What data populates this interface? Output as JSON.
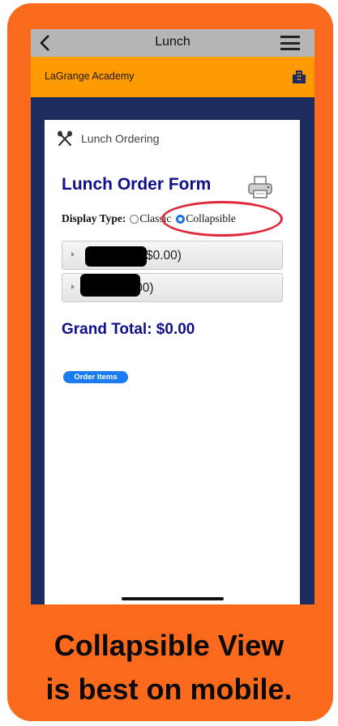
{
  "topbar": {
    "title": "Lunch",
    "back_icon": "chevron-left-icon",
    "menu_icon": "hamburger-menu-icon"
  },
  "school": {
    "name": "LaGrange Academy",
    "icon": "building-icon"
  },
  "card": {
    "header_label": "Lunch Ordering",
    "header_icon": "utensils-icon",
    "form_title": "Lunch Order Form",
    "print_icon": "printer-icon",
    "display_type": {
      "label": "Display Type:",
      "options": [
        "Classic",
        "Collapsible"
      ],
      "selected": "Collapsible"
    },
    "items": [
      {
        "label": "$0.00)"
      },
      {
        "label": "(0.00)"
      }
    ],
    "grand_total": "Grand Total: $0.00",
    "order_button": "Order Items"
  },
  "caption": {
    "line1": "Collapsible View",
    "line2": "is best on mobile."
  },
  "colors": {
    "frame": "#fb6a1c",
    "schoolbar": "#ff9a00",
    "screen_bg": "#1c2c5e",
    "title_blue": "#0f0f8c",
    "button_blue": "#1a7cf0",
    "highlight_red": "#e02a3c"
  }
}
